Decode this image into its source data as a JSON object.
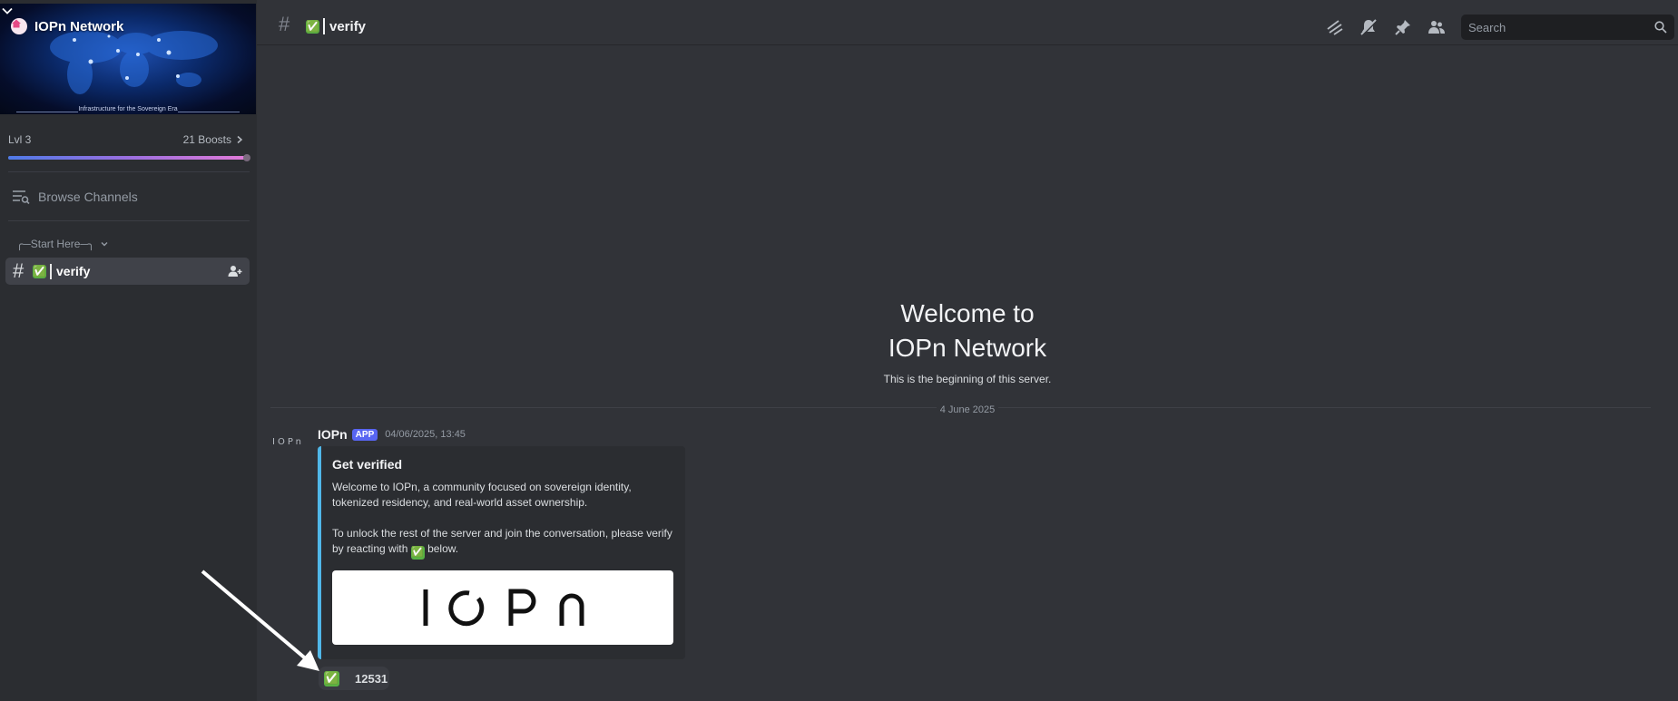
{
  "server": {
    "name": "IOPn Network",
    "banner_caption": "Infrastructure for the Sovereign Era",
    "level": "Lvl 3",
    "boosts": "21 Boosts",
    "boost_progress": 0.98
  },
  "sidebar": {
    "browse_label": "Browse Channels",
    "category_label": "Start Here",
    "channels": [
      {
        "emoji": "✅",
        "name": "verify"
      }
    ]
  },
  "header": {
    "emoji": "✅",
    "channel_name": "verify",
    "search_placeholder": "Search"
  },
  "welcome": {
    "line1": "Welcome to",
    "line2": "IOPn Network",
    "subtitle": "This is the beginning of this server."
  },
  "date_divider": "4 June 2025",
  "message": {
    "avatar_text": "IOPn",
    "author": "IOPn",
    "badge": "APP",
    "timestamp": "04/06/2025, 13:45",
    "embed": {
      "title": "Get verified",
      "paragraph1": "Welcome to IOPn, a community focused on sovereign identity, tokenized residency, and real-world asset ownership.",
      "paragraph2_before": "To unlock the rest of the server and join the conversation, please verify by reacting with",
      "paragraph2_emoji": "✅",
      "paragraph2_after": "below.",
      "image_logo_text": "IOPn"
    },
    "reaction": {
      "emoji": "✅",
      "count": "12531"
    }
  },
  "colors": {
    "accent_blurple": "#5865f2",
    "embed_border": "#50b7e8",
    "check_green": "#58b343"
  }
}
